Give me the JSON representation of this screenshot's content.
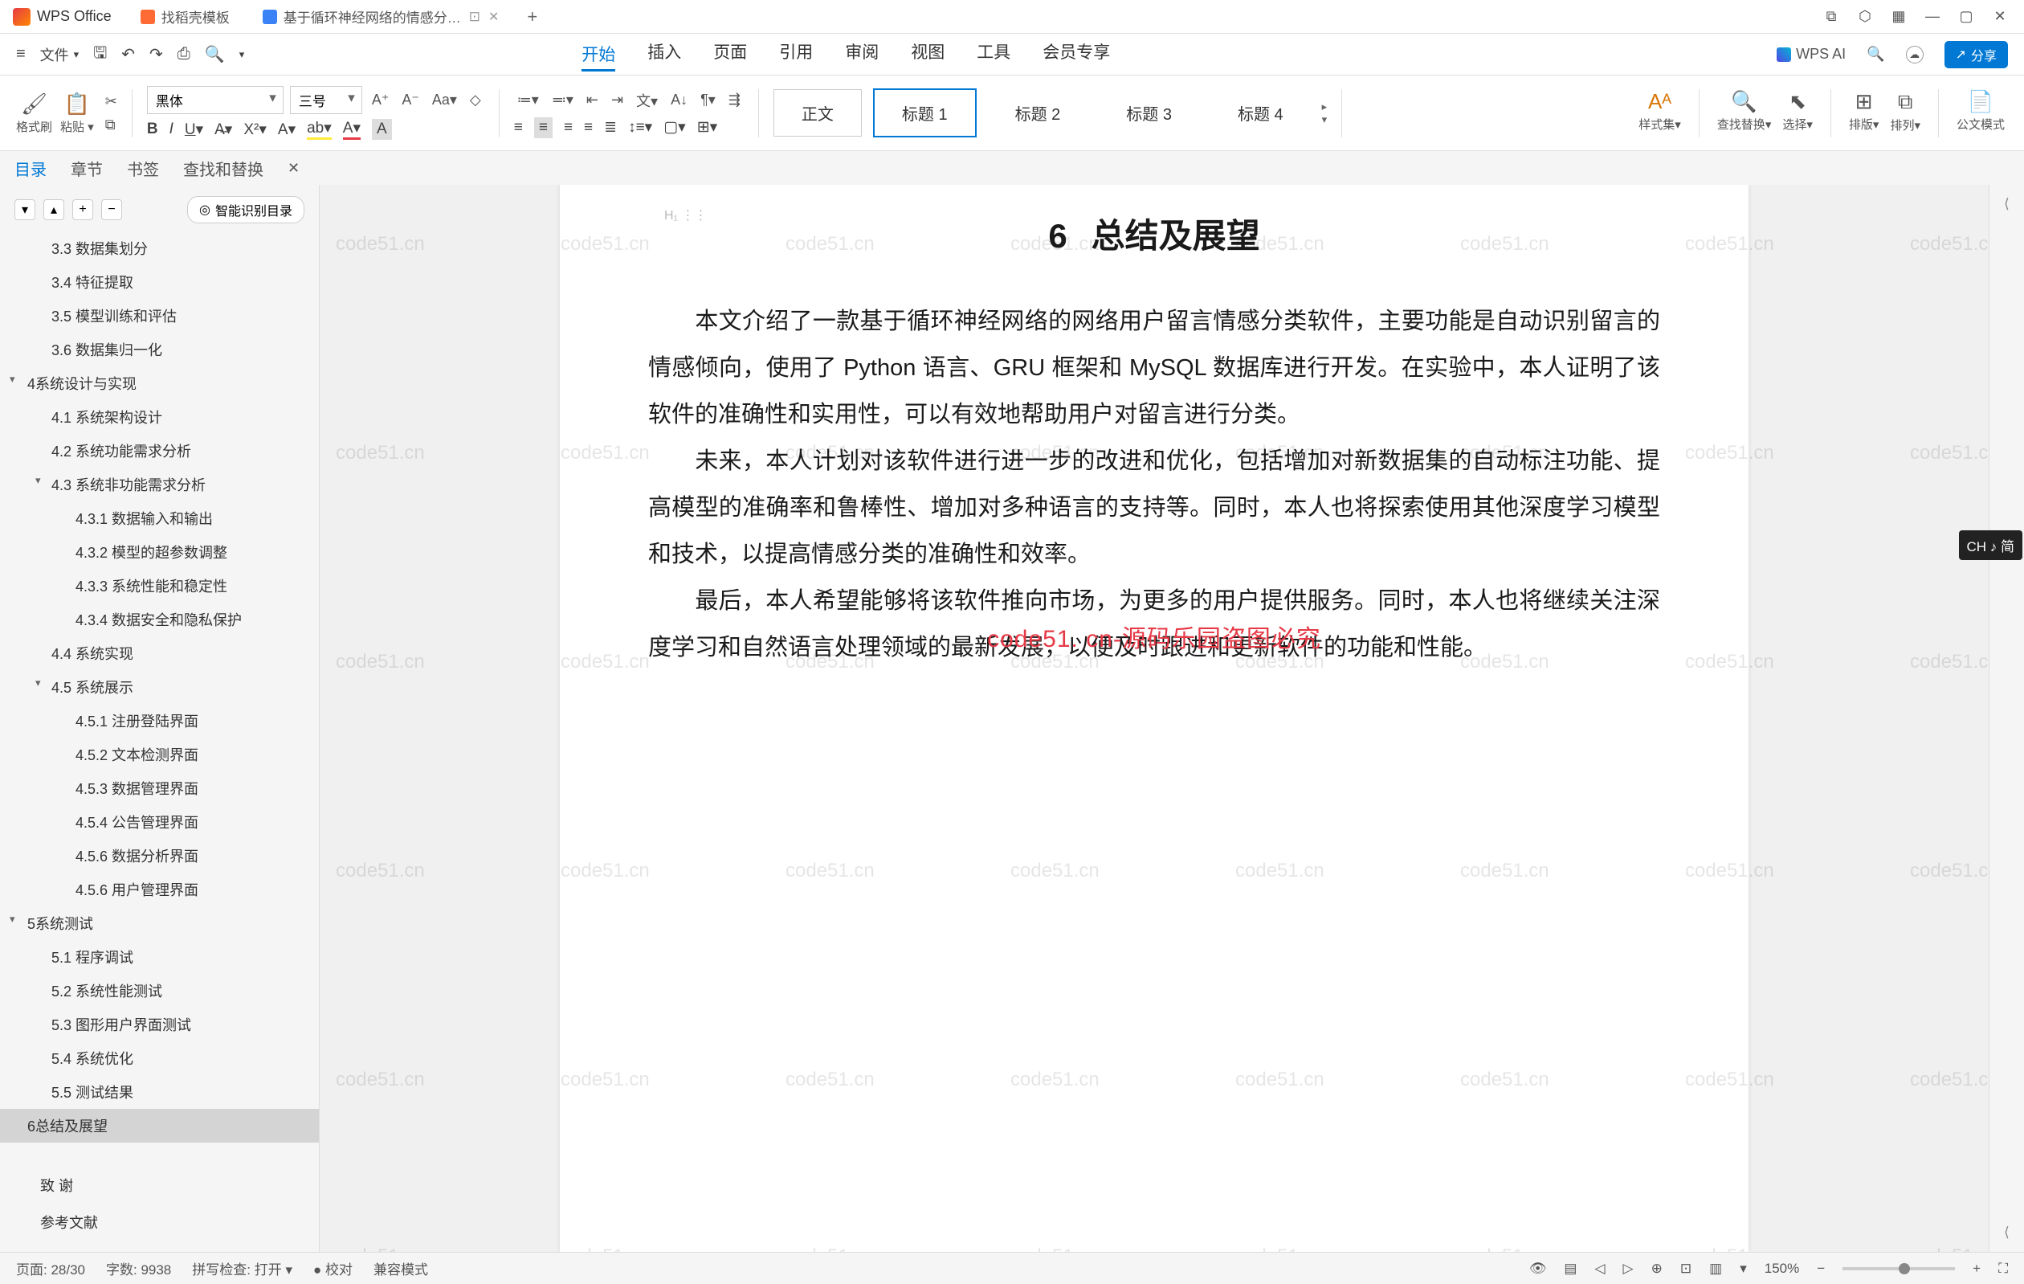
{
  "titlebar": {
    "app_name": "WPS Office",
    "tabs": [
      {
        "label": "找稻壳模板",
        "icon": "orange"
      },
      {
        "label": "基于循环神经网络的情感分…",
        "icon": "blue",
        "active": true
      }
    ],
    "new_tab": "+"
  },
  "menubar": {
    "file": "文件",
    "items": [
      "开始",
      "插入",
      "页面",
      "引用",
      "审阅",
      "视图",
      "工具",
      "会员专享"
    ],
    "active": "开始",
    "wps_ai": "WPS AI",
    "share": "分享"
  },
  "ribbon": {
    "format_painter": "格式刷",
    "paste": "粘贴",
    "font_name": "黑体",
    "font_size": "三号",
    "styles_label": "样式集",
    "find_replace": "查找替换",
    "select": "选择",
    "layout": "排版",
    "arrange": "排列",
    "doc_mode": "公文模式",
    "style_boxes": [
      "正文",
      "标题  1",
      "标题  2",
      "标题  3",
      "标题  4"
    ],
    "style_active": 1
  },
  "sidepanel": {
    "tabs": [
      "目录",
      "章节",
      "书签",
      "查找和替换"
    ],
    "active": "目录",
    "smart_button": "智能识别目录"
  },
  "outline": [
    {
      "lv": 2,
      "label": "3.3 数据集划分"
    },
    {
      "lv": 2,
      "label": "3.4 特征提取"
    },
    {
      "lv": 2,
      "label": "3.5 模型训练和评估"
    },
    {
      "lv": 2,
      "label": "3.6 数据集归一化"
    },
    {
      "lv": 1,
      "label": "4系统设计与实现",
      "tri": true
    },
    {
      "lv": 2,
      "label": "4.1 系统架构设计"
    },
    {
      "lv": 2,
      "label": "4.2 系统功能需求分析"
    },
    {
      "lv": 2,
      "label": "4.3 系统非功能需求分析",
      "tri": true
    },
    {
      "lv": 3,
      "label": "4.3.1 数据输入和输出"
    },
    {
      "lv": 3,
      "label": "4.3.2 模型的超参数调整"
    },
    {
      "lv": 3,
      "label": "4.3.3 系统性能和稳定性"
    },
    {
      "lv": 3,
      "label": "4.3.4 数据安全和隐私保护"
    },
    {
      "lv": 2,
      "label": "4.4 系统实现"
    },
    {
      "lv": 2,
      "label": "4.5 系统展示",
      "tri": true
    },
    {
      "lv": 3,
      "label": "4.5.1 注册登陆界面"
    },
    {
      "lv": 3,
      "label": "4.5.2 文本检测界面"
    },
    {
      "lv": 3,
      "label": "4.5.3 数据管理界面"
    },
    {
      "lv": 3,
      "label": "4.5.4 公告管理界面"
    },
    {
      "lv": 3,
      "label": "4.5.6 数据分析界面"
    },
    {
      "lv": 3,
      "label": "4.5.6 用户管理界面"
    },
    {
      "lv": 1,
      "label": "5系统测试",
      "tri": true
    },
    {
      "lv": 2,
      "label": "5.1 程序调试"
    },
    {
      "lv": 2,
      "label": "5.2 系统性能测试"
    },
    {
      "lv": 2,
      "label": "5.3 图形用户界面测试"
    },
    {
      "lv": 2,
      "label": "5.4 系统优化"
    },
    {
      "lv": 2,
      "label": "5.5 测试结果"
    },
    {
      "lv": 1,
      "label": "6总结及展望",
      "active": true
    },
    {
      "lv": 1,
      "label": "",
      "spacer": true
    }
  ],
  "outline_footer": [
    "致  谢",
    "参考文献"
  ],
  "document": {
    "header_mark": "H₁ ⋮⋮",
    "title_num": "6",
    "title": "总结及展望",
    "p1": "本文介绍了一款基于循环神经网络的网络用户留言情感分类软件，主要功能是自动识别留言的情感倾向，使用了 Python 语言、GRU 框架和 MySQL 数据库进行开发。在实验中，本人证明了该软件的准确性和实用性，可以有效地帮助用户对留言进行分类。",
    "p2": "未来，本人计划对该软件进行进一步的改进和优化，包括增加对新数据集的自动标注功能、提高模型的准确率和鲁棒性、增加对多种语言的支持等。同时，本人也将探索使用其他深度学习模型和技术，以提高情感分类的准确性和效率。",
    "p3": "最后，本人希望能够将该软件推向市场，为更多的用户提供服务。同时，本人也将继续关注深度学习和自然语言处理领域的最新发展，以便及时跟进和更新软件的功能和性能。",
    "watermark_red": "code51. cn-源码乐园盗图必究",
    "watermark_gray": "code51.cn"
  },
  "ime": "CH ♪ 简",
  "statusbar": {
    "page": "页面: 28/30",
    "words": "字数: 9938",
    "spellcheck": "拼写检查: 打开",
    "proof": "校对",
    "compat": "兼容模式",
    "zoom": "150%"
  }
}
